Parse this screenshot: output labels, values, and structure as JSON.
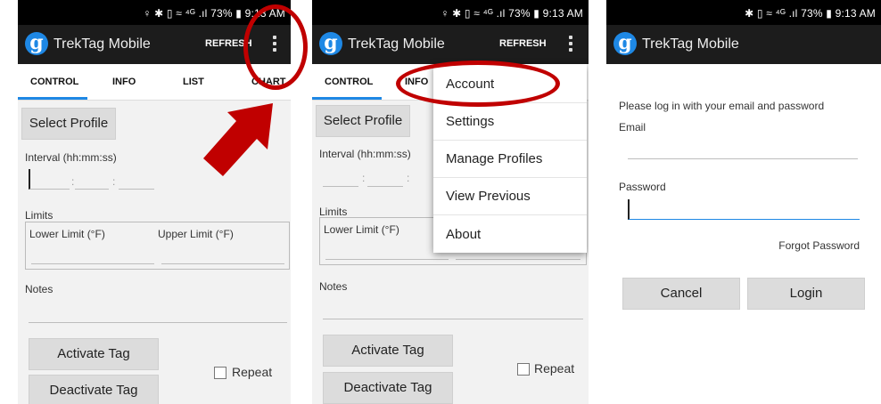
{
  "status": {
    "left": "♀ ✱ ▯ ≈ ⁴ᴳ .ıl 73% ▮ 9:13 AM",
    "mid": "♀ ✱ ▯ ≈ ⁴ᴳ .ıl 73% ▮ 9:13 AM",
    "right": "✱ ▯ ≈ ⁴ᴳ .ıl 73% ▮ 9:13 AM"
  },
  "app": {
    "logo_glyph": "g",
    "title": "TrekTag Mobile",
    "refresh_label": "REFRESH"
  },
  "tabs": [
    "CONTROL",
    "INFO",
    "LIST",
    "CHART"
  ],
  "tabs_mid_visible": [
    "CONTROL",
    "INFO"
  ],
  "control": {
    "select_profile": "Select Profile",
    "interval_label": "Interval (hh:mm:ss)",
    "colon": ":",
    "limits_label": "Limits",
    "lower_limit": "Lower Limit (°F)",
    "upper_limit": "Upper Limit (°F)",
    "notes_label": "Notes",
    "activate": "Activate Tag",
    "deactivate": "Deactivate Tag",
    "repeat": "Repeat"
  },
  "menu": [
    "Account",
    "Settings",
    "Manage Profiles",
    "View Previous",
    "About"
  ],
  "login": {
    "prompt": "Please log in with your email and password",
    "email_label": "Email",
    "password_label": "Password",
    "forgot": "Forgot Password",
    "cancel": "Cancel",
    "login": "Login"
  },
  "colors": {
    "accent": "#1e88e5",
    "annotation": "#c00000",
    "appbar": "#1c1c1c"
  }
}
